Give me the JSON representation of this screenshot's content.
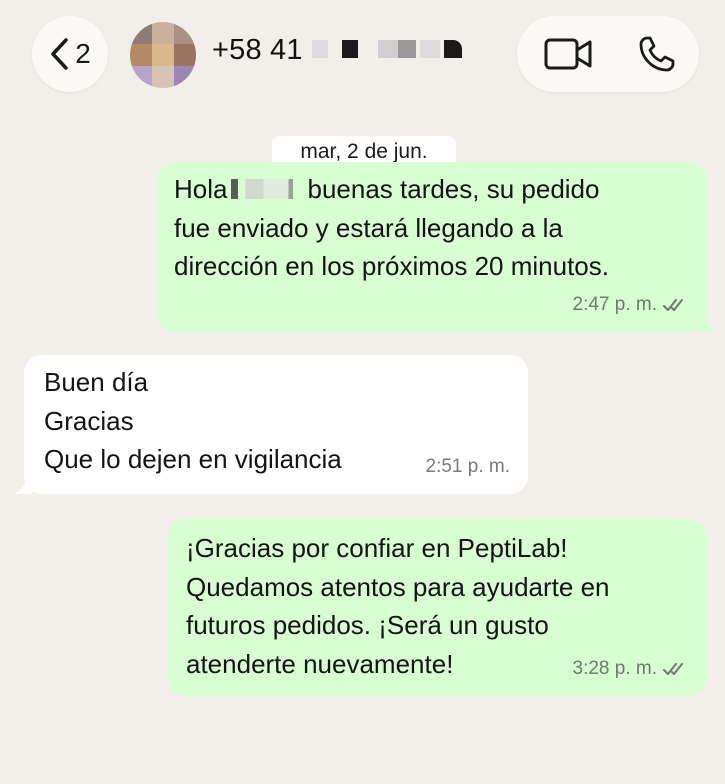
{
  "header": {
    "back_count": "2",
    "contact_number": "+58 41",
    "video_call_icon": "video-camera-icon",
    "voice_call_icon": "phone-icon",
    "back_icon": "chevron-left-icon"
  },
  "chat": {
    "date_label": "mar, 2 de jun.",
    "messages": [
      {
        "direction": "outgoing",
        "line1_prefix": "Hola",
        "line1_suffix": "buenas tardes, su pedido",
        "rest": "fue enviado y estará llegando a la\ndirección en los próximos 20 minutos.",
        "time": "2:47 p. m.",
        "status": "read"
      },
      {
        "direction": "incoming",
        "text": "Buen día\nGracias\nQue lo dejen en vigilancia",
        "time": "2:51 p. m."
      },
      {
        "direction": "outgoing",
        "text": "¡Gracias por confiar en PeptiLab!\nQuedamos atentos para ayudarte en\nfuturos pedidos. ¡Será un gusto\natenderte nuevamente!",
        "time": "3:28 p. m.",
        "status": "read"
      }
    ]
  },
  "colors": {
    "background": "#f2efeb",
    "outgoing_bubble": "#d9fdd3",
    "incoming_bubble": "#ffffff",
    "read_ticks": "#6d7a6c"
  }
}
